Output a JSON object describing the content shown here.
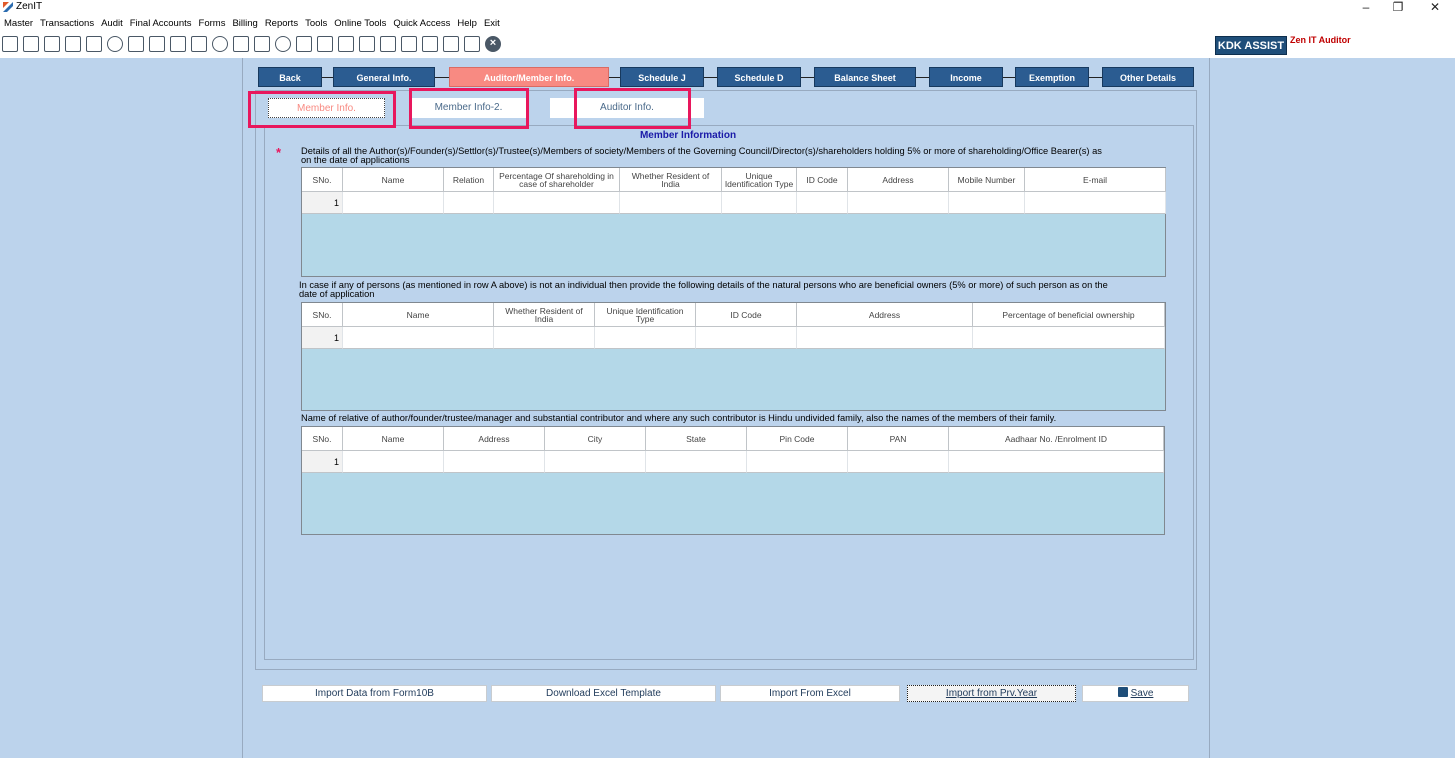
{
  "window": {
    "title": "ZenIT",
    "minimize": "–",
    "restore": "❐",
    "close": "✕"
  },
  "menu": [
    "Master",
    "Transactions",
    "Audit",
    "Final Accounts",
    "Forms",
    "Billing",
    "Reports",
    "Tools",
    "Online Tools",
    "Quick Access",
    "Help",
    "Exit"
  ],
  "toolbar_icons": [
    "report-icon",
    "home-icon",
    "grid-icon",
    "chart-icon",
    "gift-icon",
    "users-icon",
    "tools-icon",
    "filter-icon",
    "calculator-tax-icon",
    "calculator-icon",
    "pie-icon",
    "user-upload-icon",
    "document-icon",
    "info-icon",
    "sheet-icon",
    "export-icon",
    "calendar-icon",
    "sync-icon",
    "transfer-icon",
    "list-icon",
    "doc-icon",
    "print-icon",
    "badge-icon",
    "close-icon"
  ],
  "brand": {
    "kdk_assist": "KDK ASSIST",
    "product": "Zen IT Auditor",
    "kdk_color": "#1f4e79",
    "product_color": "#c00000"
  },
  "tabs": [
    {
      "label": "Back",
      "active": false
    },
    {
      "label": "General Info.",
      "active": false
    },
    {
      "label": "Auditor/Member Info.",
      "active": true
    },
    {
      "label": "Schedule J",
      "active": false
    },
    {
      "label": "Schedule D",
      "active": false
    },
    {
      "label": "Balance Sheet",
      "active": false
    },
    {
      "label": "Income",
      "active": false
    },
    {
      "label": "Exemption",
      "active": false
    },
    {
      "label": "Other Details",
      "active": false
    }
  ],
  "subtabs": [
    {
      "label": "Member Info.",
      "active": true
    },
    {
      "label": "Member Info-2.",
      "active": false
    },
    {
      "label": "Auditor Info.",
      "active": false
    }
  ],
  "section_title": "Member Information",
  "required_mark": "*",
  "grid1": {
    "description_line1": "Details of all the Author(s)/Founder(s)/Settlor(s)/Trustee(s)/Members of society/Members of the Governing Council/Director(s)/shareholders holding 5% or more of shareholding/Office Bearer(s) as",
    "description_line2": "on the date of applications",
    "columns": [
      "SNo.",
      "Name",
      "Relation",
      "Percentage Of shareholding in case of shareholder",
      "Whether Resident of India",
      "Unique Identification Type",
      "ID Code",
      "Address",
      "Mobile Number",
      "E-mail"
    ],
    "rows": [
      {
        "sno": "1"
      }
    ]
  },
  "grid2": {
    "description_line1": "In case if any of persons (as mentioned in row A above) is not an individual then provide the following details of the natural persons who are beneficial owners (5% or more) of such person as on the",
    "description_line2": "date of application",
    "columns": [
      "SNo.",
      "Name",
      "Whether Resident of India",
      "Unique Identification Type",
      "ID Code",
      "Address",
      "Percentage of beneficial ownership"
    ],
    "rows": [
      {
        "sno": "1"
      }
    ]
  },
  "grid3": {
    "description_line1": "Name of relative of author/founder/trustee/manager and substantial contributor and where any such contributor is Hindu undivided family, also the names of the members of their family.",
    "columns": [
      "SNo.",
      "Name",
      "Address",
      "City",
      "State",
      "Pin Code",
      "PAN",
      "Aadhaar No. /Enrolment ID"
    ],
    "rows": [
      {
        "sno": "1"
      }
    ]
  },
  "buttons": {
    "import_form10b": "Import Data from Form10B",
    "download_template": "Download  Excel Template",
    "import_excel": "Import From Excel",
    "import_prev_year": "Import from Prv.Year",
    "save": "Save"
  },
  "colors": {
    "highlight": "#e8175d",
    "tab_active": "#f88a82",
    "tab_normal": "#2b5c91",
    "background": "#bcd3ec",
    "grid_body": "#b4d8e8"
  }
}
